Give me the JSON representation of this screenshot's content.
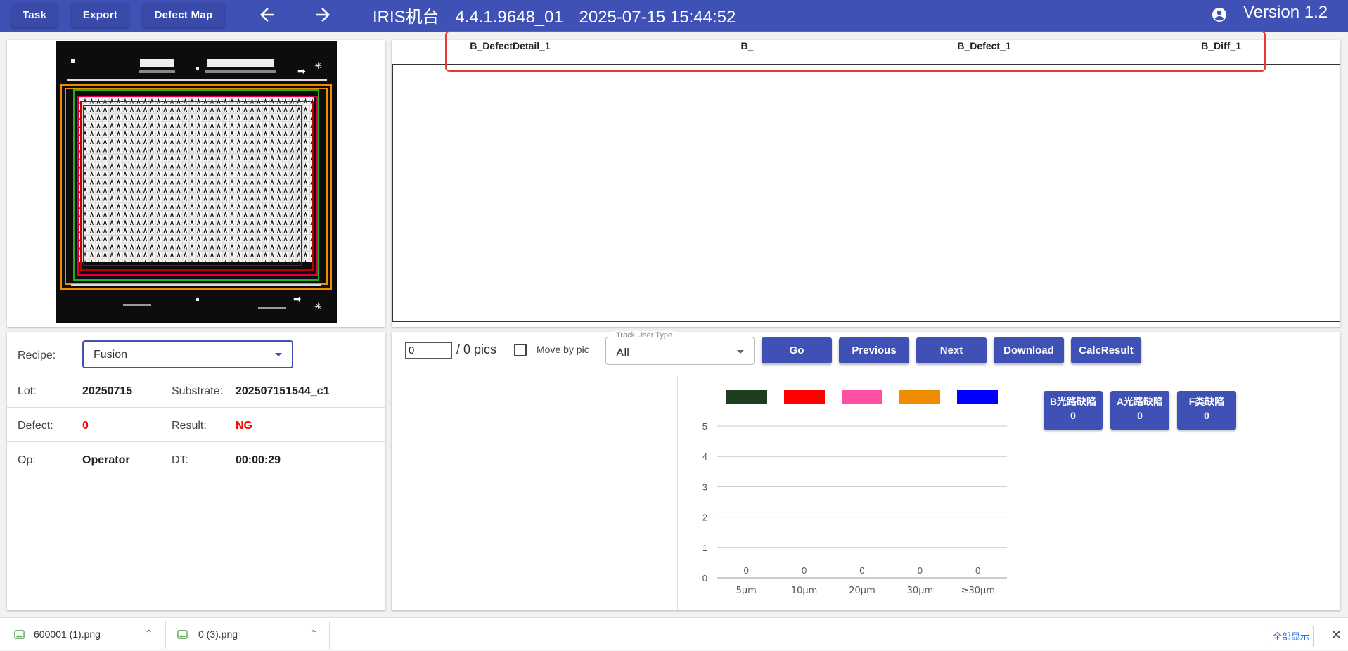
{
  "toolbar": {
    "task_label": "Task",
    "export_label": "Export",
    "defect_map_label": "Defect Map"
  },
  "header": {
    "title": "IRIS机台",
    "build": "4.4.1.9648_01",
    "datetime": "2025-07-15 15:44:52",
    "version": "Version 1.2"
  },
  "image_panel": {
    "headers": [
      "B_DefectDetail_1",
      "B_",
      "B_Defect_1",
      "B_Diff_1"
    ]
  },
  "info": {
    "recipe_label": "Recipe:",
    "recipe_value": "Fusion",
    "lot_label": "Lot:",
    "lot_value": "20250715",
    "substrate_label": "Substrate:",
    "substrate_value": "202507151544_c1",
    "defect_label": "Defect:",
    "defect_value": "0",
    "result_label": "Result:",
    "result_value": "NG",
    "op_label": "Op:",
    "op_value": "Operator",
    "dt_label": "DT:",
    "dt_value": "00:00:29"
  },
  "controls": {
    "pic_index": "0",
    "pics_total": "/ 0 pics",
    "move_by_pic_label": "Move by pic",
    "move_by_pic_checked": false,
    "track_user_type_label": "Track User Type",
    "track_user_type_value": "All",
    "go_label": "Go",
    "previous_label": "Previous",
    "next_label": "Next",
    "download_label": "Download",
    "calc_result_label": "CalcResult"
  },
  "chart_data": {
    "type": "bar",
    "categories": [
      "5μm",
      "10μm",
      "20μm",
      "30μm",
      "≥30μm"
    ],
    "values": [
      0,
      0,
      0,
      0,
      0
    ],
    "data_labels": [
      "0",
      "0",
      "0",
      "0",
      "0"
    ],
    "ylim": [
      0,
      5
    ],
    "yticks": [
      0,
      1,
      2,
      3,
      4,
      5
    ],
    "grid": true,
    "legend_colors": [
      "#1e3d1e",
      "#ff0000",
      "#ff4fa3",
      "#f08c00",
      "#0000ff"
    ],
    "legend_position": "top"
  },
  "defect_buttons": [
    {
      "label": "B光路缺陷",
      "count": "0"
    },
    {
      "label": "A光路缺陷",
      "count": "0"
    },
    {
      "label": "F类缺陷",
      "count": "0"
    }
  ],
  "downloads": {
    "items": [
      {
        "name": "600001 (1).png"
      },
      {
        "name": "0 (3).png"
      }
    ],
    "show_all_label": "全部显示"
  },
  "colors": {
    "primary": "#3f51b5",
    "error_text": "#ff0000"
  }
}
